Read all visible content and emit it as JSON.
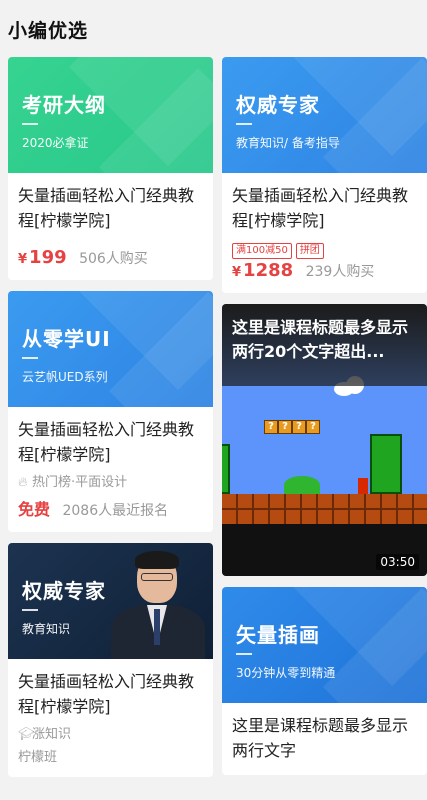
{
  "page": {
    "title": "小编优选"
  },
  "cards": {
    "c1": {
      "banner_title": "考研大纲",
      "banner_sub": "2020必拿证",
      "title": "矢量插画轻松入门经典教程[柠檬学院]",
      "price_symbol": "¥",
      "price": "199",
      "buyers": "506人购买"
    },
    "c2": {
      "banner_title": "权威专家",
      "banner_sub": "教育知识/ 备考指导",
      "title": "矢量插画轻松入门经典教程[柠檬学院]",
      "tags": [
        "满100减50",
        "拼团"
      ],
      "price_symbol": "¥",
      "price": "1288",
      "buyers": "239人购买"
    },
    "c3": {
      "banner_title": "从零学UI",
      "banner_sub": "云艺帆UED系列",
      "title": "矢量插画轻松入门经典教程[柠檬学院]",
      "meta": "热门榜·平面设计",
      "free": "免费",
      "enrolled": "2086人最近报名"
    },
    "c4": {
      "video_title": "这里是课程标题最多显示两行20个文字超出...",
      "duration": "03:50"
    },
    "c5": {
      "banner_title": "权威专家",
      "banner_sub": "教育知识",
      "title": "矢量插画轻松入门经典教程[柠檬学院]",
      "meta": "涨知识",
      "org": "柠檬班"
    },
    "c6": {
      "banner_title": "矢量插画",
      "banner_sub": "30分钟从零到精通",
      "title": "这里是课程标题最多显示两行文字"
    }
  },
  "icons": {
    "fire": "fire-icon",
    "graduation": "graduation-cap-icon"
  },
  "colors": {
    "price": "#e64242",
    "green_banner": "#36d391",
    "blue_banner": "#3b9bf0",
    "dark_banner": "#1c3350"
  }
}
